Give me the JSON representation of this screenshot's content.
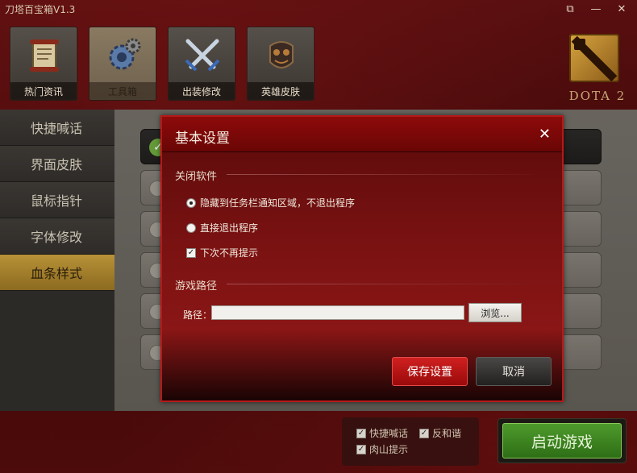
{
  "app": {
    "title": "刀塔百宝箱V1.3"
  },
  "window_controls": [
    {
      "name": "feedback-icon",
      "glyph": "⧉"
    },
    {
      "name": "minimize-icon",
      "glyph": "—"
    },
    {
      "name": "close-icon",
      "glyph": "✕"
    }
  ],
  "nav": {
    "tiles": [
      {
        "label": "热门资讯",
        "icon": "scroll-icon",
        "active": false
      },
      {
        "label": "工具箱",
        "icon": "gear-icon",
        "active": true
      },
      {
        "label": "出装修改",
        "icon": "crossed-swords-icon",
        "active": false
      },
      {
        "label": "英雄皮肤",
        "icon": "armor-icon",
        "active": false
      }
    ]
  },
  "logo": {
    "text": "DOTA 2",
    "accent": "#c8a040"
  },
  "sidebar": {
    "items": [
      {
        "label": "快捷喊话",
        "active": false
      },
      {
        "label": "界面皮肤",
        "active": false
      },
      {
        "label": "鼠标指针",
        "active": false
      },
      {
        "label": "字体修改",
        "active": false
      },
      {
        "label": "血条样式",
        "active": true
      }
    ]
  },
  "bottom": {
    "options": [
      {
        "label": "快捷喊话",
        "checked": true
      },
      {
        "label": "反和谐",
        "checked": true
      },
      {
        "label": "肉山提示",
        "checked": true
      }
    ],
    "start_label": "启动游戏"
  },
  "dialog": {
    "title": "基本设置",
    "close_glyph": "✕",
    "section_close": "关闭软件",
    "radio_hide": "隐藏到任务栏通知区域，不退出程序",
    "radio_hide_selected": true,
    "radio_exit": "直接退出程序",
    "checkbox_no_prompt": "下次不再提示",
    "checkbox_no_prompt_checked": true,
    "section_path": "游戏路径",
    "path_label": "路径：",
    "path_value": "",
    "browse_label": "浏览...",
    "save_label": "保存设置",
    "cancel_label": "取消"
  },
  "colors": {
    "dialog_border": "#b81818",
    "save_button": "#c01818",
    "sidebar_active": "#b89238",
    "start_button": "#3e8a22"
  }
}
